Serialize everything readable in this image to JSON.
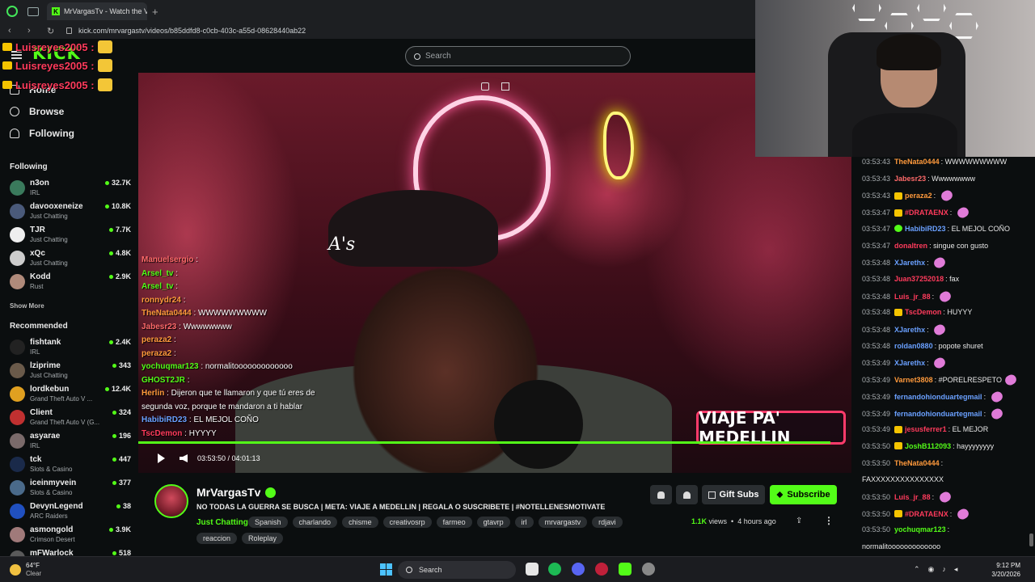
{
  "browser": {
    "tab_title": "MrVargasTv - Watch the V",
    "tab_close": "×",
    "new_tab": "+",
    "url": "kick.com/mrvargastv/videos/b85ddfd8-c0cb-403c-a55d-08628440ab22",
    "back": "‹",
    "forward": "›",
    "reload": "↻"
  },
  "kick": {
    "logo": "KICK",
    "search_placeholder": "Search"
  },
  "overlay_names": [
    "Luisreyes2005 :",
    "Luisreyes2005 :",
    "Luisreyes2005 :"
  ],
  "sidebar": {
    "nav": [
      {
        "label": "Home",
        "icon": "home-icon"
      },
      {
        "label": "Browse",
        "icon": "browse-icon"
      },
      {
        "label": "Following",
        "icon": "heart-icon"
      }
    ],
    "following_header": "Following",
    "following": [
      {
        "name": "n3on",
        "category": "IRL",
        "viewers": "32.7K",
        "color": "#3a7a5c"
      },
      {
        "name": "davooxeneize",
        "category": "Just Chatting",
        "viewers": "10.8K",
        "color": "#4a5a7a"
      },
      {
        "name": "TJR",
        "category": "Just Chatting",
        "viewers": "7.7K",
        "color": "#eeeeee"
      },
      {
        "name": "xQc",
        "category": "Just Chatting",
        "viewers": "4.8K",
        "color": "#cccccc"
      },
      {
        "name": "Kodd",
        "category": "Rust",
        "viewers": "2.9K",
        "color": "#b08a7a"
      }
    ],
    "show_more": "Show More",
    "recommended_header": "Recommended",
    "recommended": [
      {
        "name": "fishtank",
        "category": "IRL",
        "viewers": "2.4K",
        "color": "#222222"
      },
      {
        "name": "lziprime",
        "category": "Just Chatting",
        "viewers": "343",
        "color": "#6a5a4a"
      },
      {
        "name": "lordkebun",
        "category": "Grand Theft Auto V ...",
        "viewers": "12.4K",
        "color": "#e0a020"
      },
      {
        "name": "Client",
        "category": "Grand Theft Auto V (G...",
        "viewers": "324",
        "color": "#c03030"
      },
      {
        "name": "asyarae",
        "category": "IRL",
        "viewers": "196",
        "color": "#7a6a6a"
      },
      {
        "name": "tck",
        "category": "Slots & Casino",
        "viewers": "447",
        "color": "#1a2a4a"
      },
      {
        "name": "iceinmyvein",
        "category": "Slots & Casino",
        "viewers": "377",
        "color": "#4a6a8a"
      },
      {
        "name": "DevynLegend",
        "category": "ARC Raiders",
        "viewers": "38",
        "color": "#2050c0"
      },
      {
        "name": "asmongold",
        "category": "Crimson Desert",
        "viewers": "3.9K",
        "color": "#a07a7a"
      },
      {
        "name": "mFWarlock",
        "category": "",
        "viewers": "518",
        "color": "#5a5a5a"
      }
    ]
  },
  "video": {
    "cap_text": "A's",
    "banner": "VIAJE PA' MEDELLIN",
    "time": "03:53:50 / 04:01:13",
    "progress_fraction": 0.97,
    "chat_overlay": [
      {
        "user": "Manuelsergio",
        "text": ":",
        "color": "#ff6a6a"
      },
      {
        "user": "Arsel_tv",
        "text": ":",
        "color": "#53fc18"
      },
      {
        "user": "Arsel_tv",
        "text": ":",
        "color": "#53fc18"
      },
      {
        "user": "ronnydr24",
        "text": ":",
        "color": "#ff9a3c"
      },
      {
        "user": "TheNata0444",
        "text": ": WWWWWWWWW",
        "color": "#ff9a3c"
      },
      {
        "user": "Jabesr23",
        "text": ": Wwwwwwww",
        "color": "#ff6a6a"
      },
      {
        "user": "peraza2",
        "text": ":",
        "color": "#ff9a3c"
      },
      {
        "user": "peraza2",
        "text": ":",
        "color": "#ff9a3c"
      },
      {
        "user": "yochuqmar123",
        "text": ": normalitooooooooooooo",
        "color": "#53fc18"
      },
      {
        "user": "GHOST2JR",
        "text": ":",
        "color": "#53fc18"
      },
      {
        "user": "Herlin",
        "text": ": Dijeron que te llamaron y que tú eres de",
        "color": "#ff9a3c"
      },
      {
        "user": "",
        "text": "segunda voz, porque te mandaron a ti hablar",
        "color": "#ffffff"
      },
      {
        "user": "HabibiRD23",
        "text": ": EL MEJOL COÑO",
        "color": "#6aa0ff"
      },
      {
        "user": "TscDemon",
        "text": ": HYYYY",
        "color": "#ff3b5c"
      }
    ]
  },
  "stream": {
    "channel": "MrVargasTv",
    "title": "NO TODAS LA GUERRA SE BUSCA | META: VIAJE A MEDELLIN | REGALA O SUSCRIBETE | #NOTELLENESMOTIVATE",
    "category": "Just Chatting",
    "tags": [
      "Spanish",
      "charlando",
      "chisme",
      "creativosrp",
      "farmeo",
      "gtavrp",
      "irl",
      "mrvargastv",
      "rdjavi"
    ],
    "tags_row2": [
      "reaccion",
      "Roleplay"
    ],
    "gift_label": "Gift Subs",
    "subscribe_label": "Subscribe",
    "views": "1.1K",
    "views_suffix": "views",
    "ago": "4 hours ago",
    "share": "⇪",
    "more": "⋮"
  },
  "chat": [
    {
      "ts": "03:53:43",
      "user": "TheNata0444",
      "sep": ":",
      "text": "WWWWWWWWW",
      "color": "#ff9a3c",
      "badge": "",
      "emote": false
    },
    {
      "ts": "03:53:43",
      "user": "Jabesr23",
      "sep": ":",
      "text": "Wwwwwwww",
      "color": "#ff6a6a",
      "badge": "",
      "emote": false
    },
    {
      "ts": "03:53:43",
      "user": "peraza2",
      "sep": ":",
      "text": "",
      "color": "#ff9a3c",
      "badge": "gold",
      "emote": true
    },
    {
      "ts": "03:53:47",
      "user": "#DRATAENX",
      "sep": ":",
      "text": "",
      "color": "#ff3b5c",
      "badge": "gold",
      "emote": true
    },
    {
      "ts": "03:53:47",
      "user": "HabibiRD23",
      "sep": ":",
      "text": "EL MEJOL COÑO",
      "color": "#6aa0ff",
      "badge": "green",
      "emote": false
    },
    {
      "ts": "03:53:47",
      "user": "donaltren",
      "sep": ":",
      "text": "singue con gusto",
      "color": "#ff3b5c",
      "badge": "",
      "emote": false
    },
    {
      "ts": "03:53:48",
      "user": "XJarethx",
      "sep": ":",
      "text": "",
      "color": "#6aa0ff",
      "badge": "",
      "emote": true
    },
    {
      "ts": "03:53:48",
      "user": "Juan37252018",
      "sep": ":",
      "text": "fax",
      "color": "#ff3b5c",
      "badge": "",
      "emote": false
    },
    {
      "ts": "03:53:48",
      "user": "Luis_jr_88",
      "sep": ":",
      "text": "",
      "color": "#ff3b5c",
      "badge": "",
      "emote": true
    },
    {
      "ts": "03:53:48",
      "user": "TscDemon",
      "sep": ":",
      "text": "HUYYY",
      "color": "#ff3b5c",
      "badge": "gold",
      "emote": false
    },
    {
      "ts": "03:53:48",
      "user": "XJarethx",
      "sep": ":",
      "text": "",
      "color": "#6aa0ff",
      "badge": "",
      "emote": true
    },
    {
      "ts": "03:53:48",
      "user": "roldan0880",
      "sep": ":",
      "text": "popote shuret",
      "color": "#6aa0ff",
      "badge": "",
      "emote": false
    },
    {
      "ts": "03:53:49",
      "user": "XJarethx",
      "sep": ":",
      "text": "",
      "color": "#6aa0ff",
      "badge": "",
      "emote": true
    },
    {
      "ts": "03:53:49",
      "user": "Varnet3808",
      "sep": ":",
      "text": "#PORELRESPETO",
      "color": "#ff9a3c",
      "badge": "",
      "emote": true
    },
    {
      "ts": "03:53:49",
      "user": "fernandohionduartegmail",
      "sep": ":",
      "text": "",
      "color": "#6aa0ff",
      "badge": "",
      "emote": true
    },
    {
      "ts": "03:53:49",
      "user": "fernandohionduartegmail",
      "sep": ":",
      "text": "",
      "color": "#6aa0ff",
      "badge": "",
      "emote": true
    },
    {
      "ts": "03:53:49",
      "user": "jesusferrer1",
      "sep": ":",
      "text": "EL MEJOR",
      "color": "#ff3b5c",
      "badge": "gold",
      "emote": false
    },
    {
      "ts": "03:53:50",
      "user": "JoshB112093",
      "sep": ":",
      "text": "hayyyyyyyy",
      "color": "#53fc18",
      "badge": "gold",
      "emote": false
    },
    {
      "ts": "03:53:50",
      "user": "TheNata0444",
      "sep": ":",
      "text": "",
      "color": "#ff9a3c",
      "badge": "",
      "emote": false
    },
    {
      "ts": "",
      "user": "",
      "sep": "",
      "text": "FAXXXXXXXXXXXXXXX",
      "color": "#e8e8e8",
      "badge": "",
      "emote": false
    },
    {
      "ts": "03:53:50",
      "user": "Luis_jr_88",
      "sep": ":",
      "text": "",
      "color": "#ff3b5c",
      "badge": "",
      "emote": true
    },
    {
      "ts": "03:53:50",
      "user": "#DRATAENX",
      "sep": ":",
      "text": "",
      "color": "#ff3b5c",
      "badge": "gold",
      "emote": true
    },
    {
      "ts": "03:53:50",
      "user": "yochuqmar123",
      "sep": ":",
      "text": "",
      "color": "#53fc18",
      "badge": "",
      "emote": false
    },
    {
      "ts": "",
      "user": "",
      "sep": "",
      "text": "normalitooooooooooooo",
      "color": "#e8e8e8",
      "badge": "",
      "emote": false
    }
  ],
  "taskbar": {
    "temp": "64°F",
    "condition": "Clear",
    "search_label": "Search",
    "time": "9:12 PM",
    "date": "3/20/2026"
  }
}
